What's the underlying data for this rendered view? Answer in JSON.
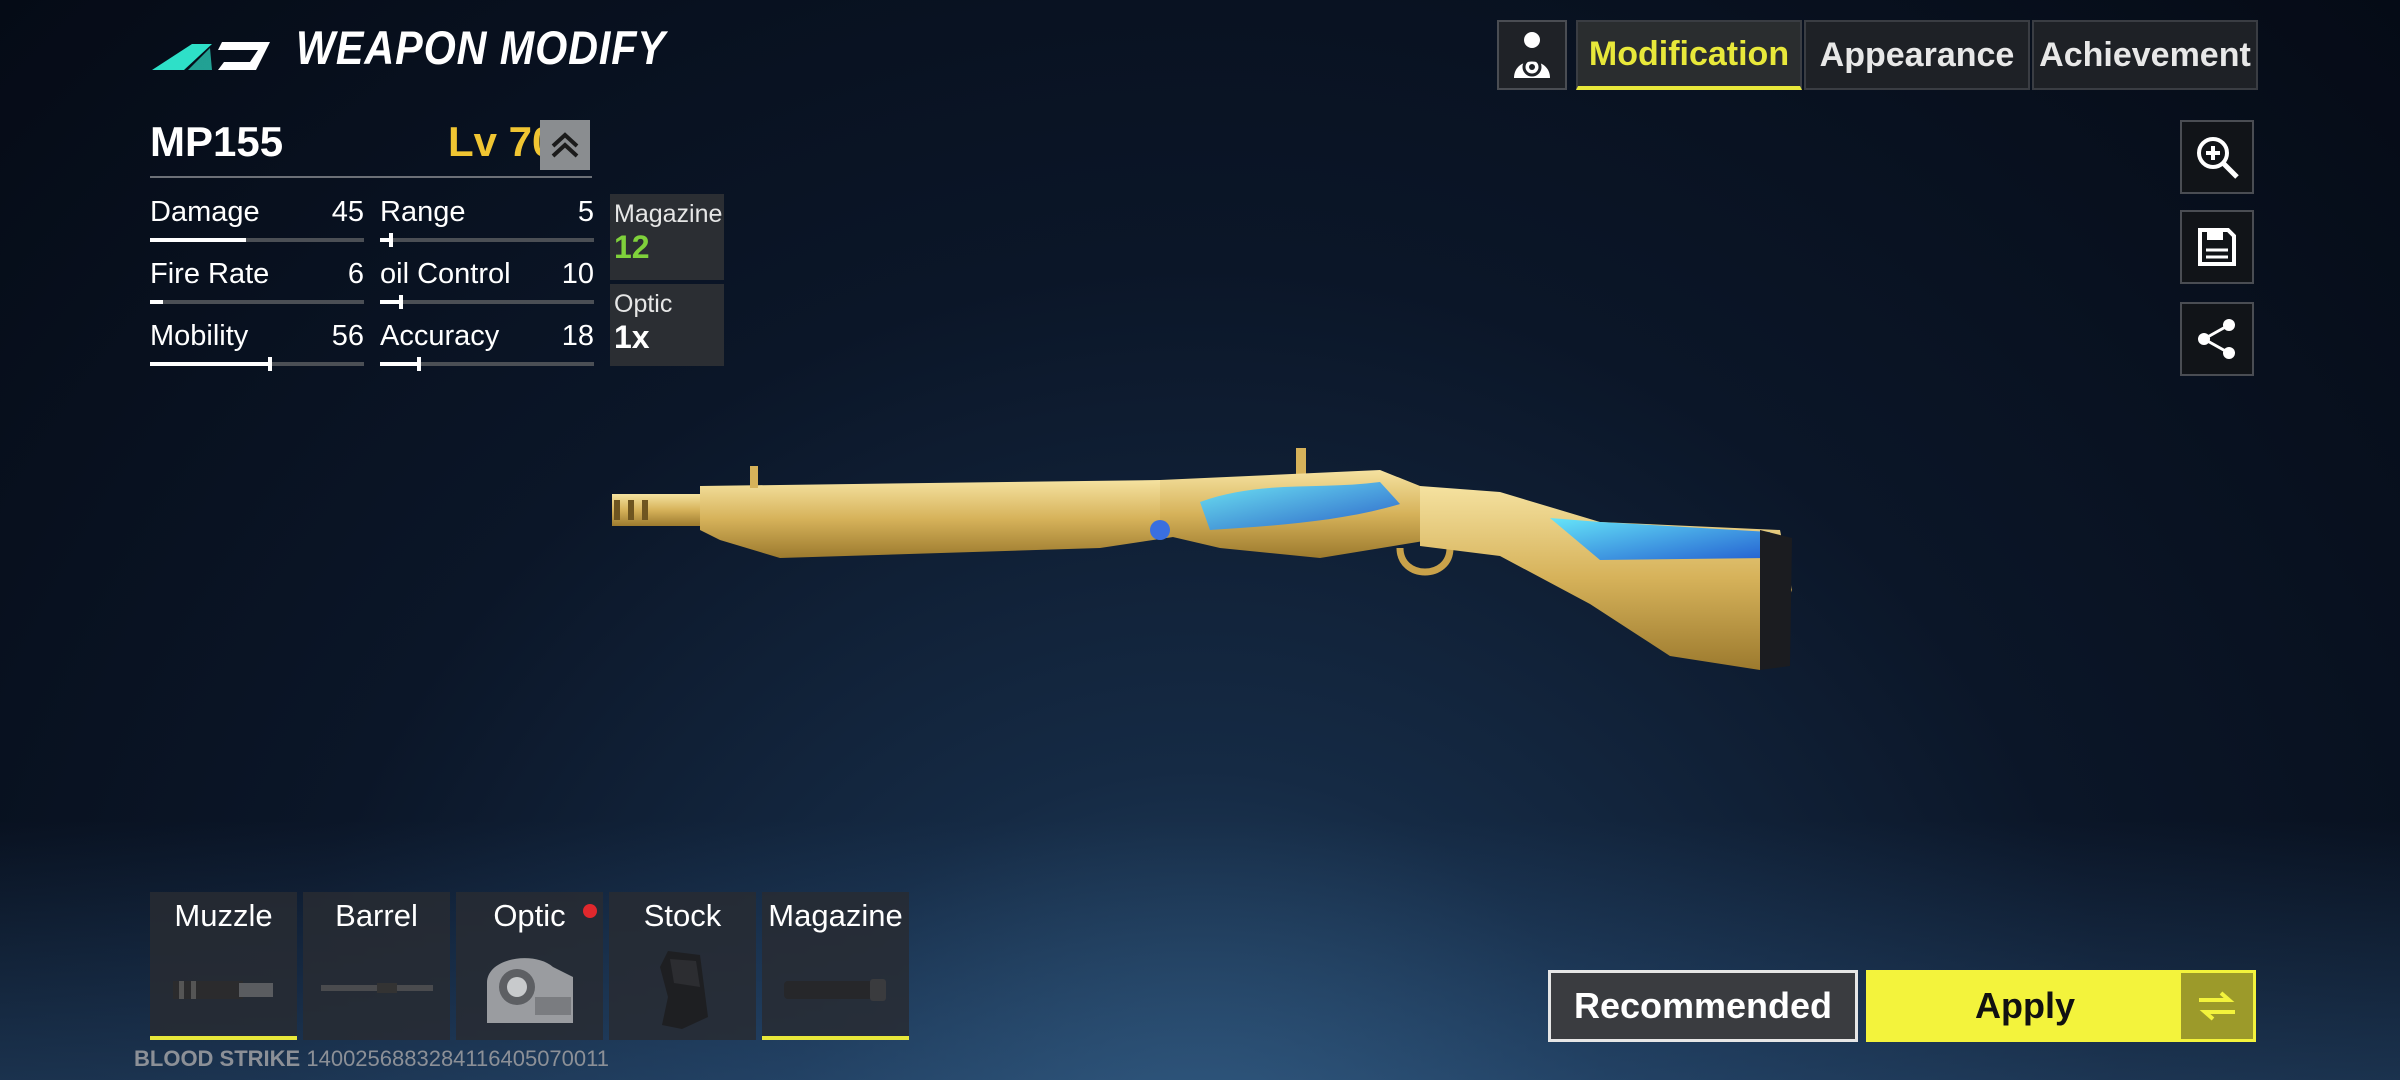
{
  "header": {
    "title": "WEAPON MODIFY"
  },
  "tabs": [
    {
      "label": "Modification",
      "active": true
    },
    {
      "label": "Appearance",
      "active": false
    },
    {
      "label": "Achievement",
      "active": false
    }
  ],
  "weapon": {
    "name": "MP155",
    "level": "Lv 70"
  },
  "stats": [
    {
      "label": "Damage",
      "value": "45",
      "fill": 0.45
    },
    {
      "label": "Range",
      "value": "5",
      "fill": 0.05
    },
    {
      "label": "Fire Rate",
      "value": "6",
      "fill": 0.06
    },
    {
      "label": "oil Control",
      "value": "10",
      "fill": 0.1
    },
    {
      "label": "Mobility",
      "value": "56",
      "fill": 0.56
    },
    {
      "label": "Accuracy",
      "value": "18",
      "fill": 0.18
    }
  ],
  "info": [
    {
      "label": "Magazine",
      "value": "12",
      "color": "#7fd13b"
    },
    {
      "label": "Optic",
      "value": "1x",
      "color": "#ffffff"
    }
  ],
  "attachments": [
    {
      "label": "Muzzle",
      "equipped": true,
      "icon": "muzzle-brake-icon"
    },
    {
      "label": "Barrel",
      "equipped": false,
      "icon": "barrel-icon"
    },
    {
      "label": "Optic",
      "equipped": false,
      "icon": "holographic-sight-icon",
      "alert": true
    },
    {
      "label": "Stock",
      "equipped": false,
      "icon": "stock-icon"
    },
    {
      "label": "Magazine",
      "equipped": true,
      "icon": "magazine-tube-icon"
    }
  ],
  "footer": {
    "game": "BLOOD STRIKE",
    "id": "1400256883284116405070011"
  },
  "buttons": {
    "recommended": "Recommended",
    "apply": "Apply"
  },
  "colors": {
    "accent": "#f3f33c",
    "level": "#f0c532",
    "logo": "#2ee0c8",
    "alert": "#e0282d"
  }
}
